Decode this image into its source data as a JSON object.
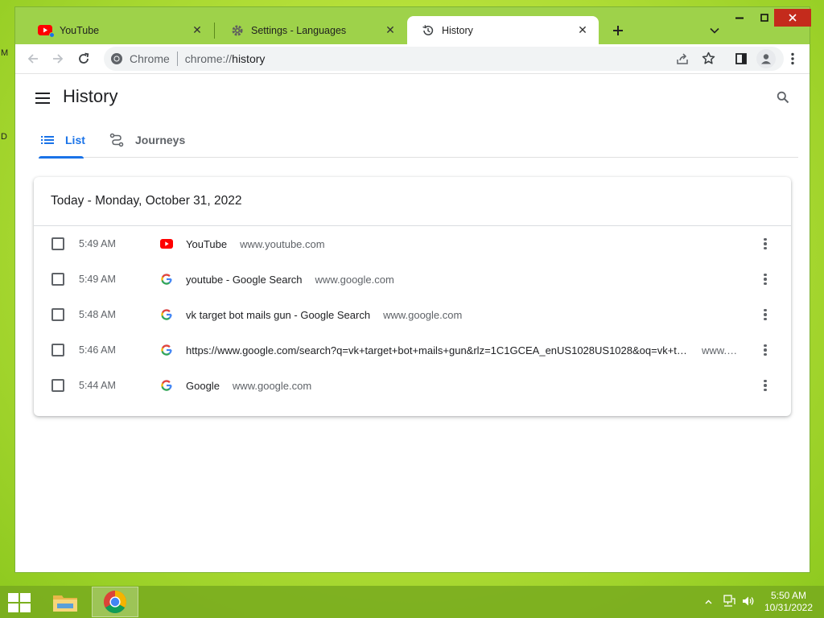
{
  "desktop": {
    "glyph_top": "M",
    "glyph_mid": "D"
  },
  "browser": {
    "tabs": [
      {
        "title": "YouTube",
        "icon": "youtube-icon",
        "active": false
      },
      {
        "title": "Settings - Languages",
        "icon": "gear-icon",
        "active": false
      },
      {
        "title": "History",
        "icon": "history-icon",
        "active": true
      }
    ],
    "omnibox": {
      "chip": "Chrome",
      "scheme": "chrome://",
      "path": "history"
    }
  },
  "history": {
    "title": "History",
    "tabs": [
      {
        "label": "List",
        "icon": "list-icon",
        "active": true
      },
      {
        "label": "Journeys",
        "icon": "journeys-icon",
        "active": false
      }
    ],
    "day_header": "Today - Monday, October 31, 2022",
    "entries": [
      {
        "time": "5:49 AM",
        "favicon": "youtube-icon",
        "title": "YouTube",
        "domain": "www.youtube.com"
      },
      {
        "time": "5:49 AM",
        "favicon": "google-icon",
        "title": "youtube - Google Search",
        "domain": "www.google.com"
      },
      {
        "time": "5:48 AM",
        "favicon": "google-icon",
        "title": "vk target bot mails gun - Google Search",
        "domain": "www.google.com"
      },
      {
        "time": "5:46 AM",
        "favicon": "google-icon",
        "title": "https://www.google.com/search?q=vk+target+bot+mails+gun&rlz=1C1GCEA_enUS1028US1028&oq=vk+target+bot+mails+gun",
        "domain": "www.google.com"
      },
      {
        "time": "5:44 AM",
        "favicon": "google-icon",
        "title": "Google",
        "domain": "www.google.com"
      }
    ]
  },
  "taskbar": {
    "time": "5:50 AM",
    "date": "10/31/2022"
  },
  "colors": {
    "accent": "#1a73e8",
    "youtube_red": "#ff0000",
    "desktop_green": "#9ed24a"
  }
}
